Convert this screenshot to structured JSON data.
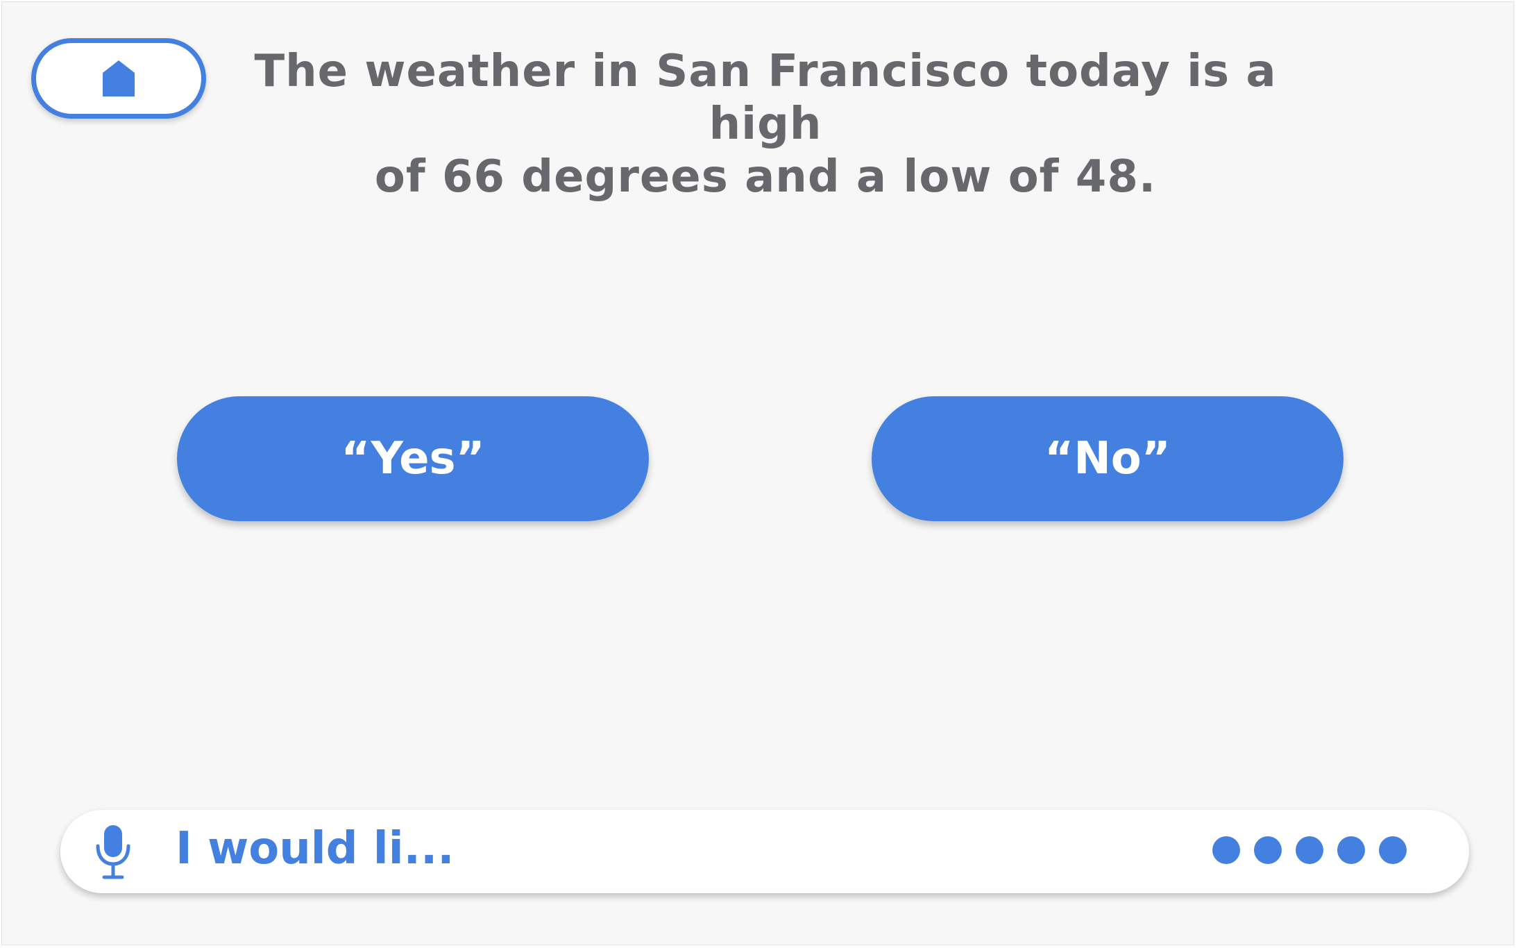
{
  "accent_color": "#4380e0",
  "text_color": "#67686b",
  "home": {
    "icon": "home-icon"
  },
  "message": {
    "line1": "The weather in San Francisco today is a high",
    "line2": "of 66 degrees and a low of 48."
  },
  "options": {
    "yes_label": "“Yes”",
    "no_label": "“No”"
  },
  "voice_input": {
    "icon": "microphone-icon",
    "transcript": "I would li...",
    "listening_indicator": "dots-indicator"
  }
}
